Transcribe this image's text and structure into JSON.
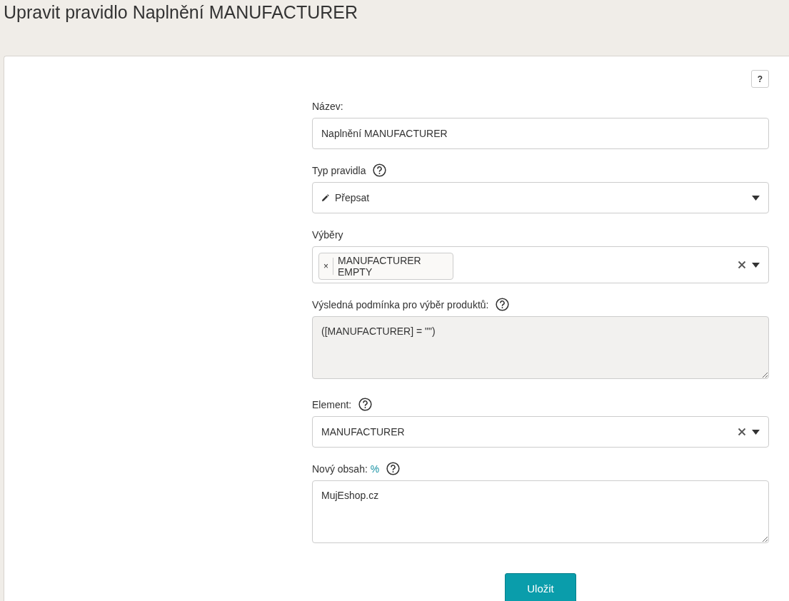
{
  "page_title": "Upravit pravidlo Naplnění MANUFACTURER",
  "help_button": "?",
  "fields": [
    {
      "kind": "text",
      "label": "Název:",
      "help": false,
      "value": "Naplnění MANUFACTURER"
    },
    {
      "kind": "select",
      "label": "Typ pravidla",
      "help": true,
      "value": "Přepsat",
      "pencil": true,
      "clearable": false
    },
    {
      "kind": "multiselect",
      "label": "Výběry",
      "help": false,
      "tags": [
        {
          "label": "MANUFACTURER EMPTY",
          "remove": "×"
        }
      ],
      "clearable": true
    },
    {
      "kind": "readonly_textarea",
      "label": "Výsledná podmínka pro výběr produktů:",
      "help": true,
      "value": "([MANUFACTURER] = \"\")"
    },
    {
      "kind": "select",
      "label": "Element:",
      "help": true,
      "value": "MANUFACTURER",
      "pencil": false,
      "clearable": true
    },
    {
      "kind": "textarea",
      "label": "Nový obsah:",
      "label_suffix": "%",
      "help": true,
      "value": "MujEshop.cz"
    }
  ],
  "save_button": "Uložit"
}
